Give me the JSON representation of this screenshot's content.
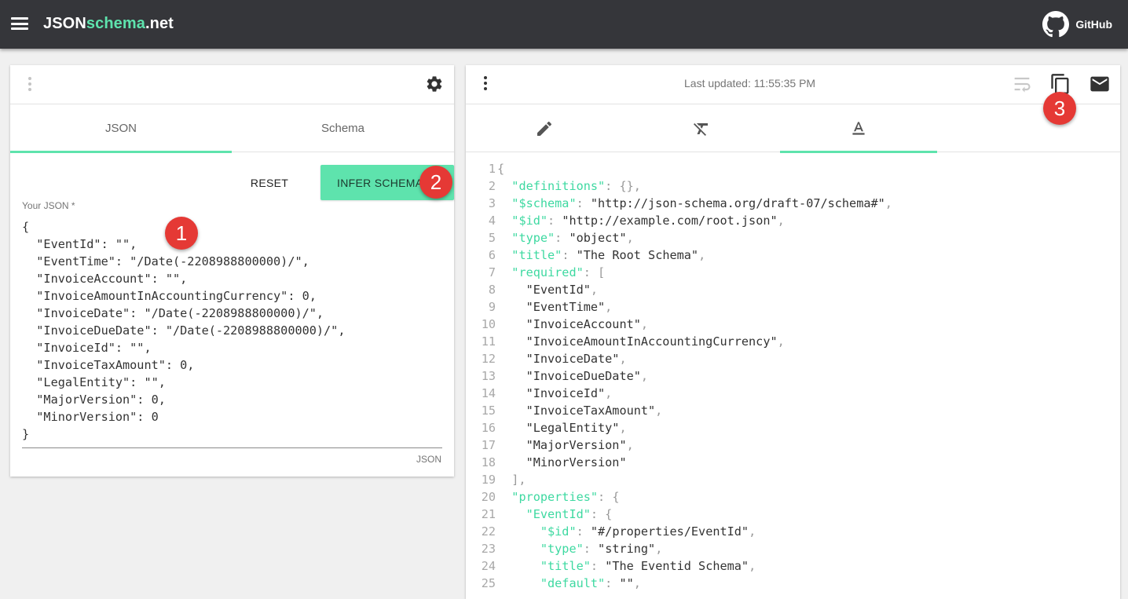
{
  "app": {
    "brand_part1": "JSON",
    "brand_part2": "schema",
    "brand_part3": ".net",
    "github_label": "GitHub"
  },
  "left_panel": {
    "tabs": [
      "JSON",
      "Schema"
    ],
    "active_tab": "JSON",
    "reset_label": "RESET",
    "infer_label": "INFER SCHEMA",
    "field_label": "Your JSON *",
    "field_hint": "JSON",
    "json_text": "{\n  \"EventId\": \"\",\n  \"EventTime\": \"/Date(-2208988800000)/\",\n  \"InvoiceAccount\": \"\",\n  \"InvoiceAmountInAccountingCurrency\": 0,\n  \"InvoiceDate\": \"/Date(-2208988800000)/\",\n  \"InvoiceDueDate\": \"/Date(-2208988800000)/\",\n  \"InvoiceId\": \"\",\n  \"InvoiceTaxAmount\": 0,\n  \"LegalEntity\": \"\",\n  \"MajorVersion\": 0,\n  \"MinorVersion\": 0\n}"
  },
  "right_panel": {
    "last_updated": "Last updated: 11:55:35 PM",
    "tabs": [
      "edit-icon",
      "clear-format-icon",
      "text-format-icon"
    ],
    "active_tab": "text-format-icon",
    "header_icons": [
      "wrap-text-icon",
      "copy-icon",
      "email-icon"
    ],
    "code_lines": [
      [
        [
          "p",
          "{"
        ]
      ],
      [
        [
          "p",
          "  "
        ],
        [
          "k",
          "\"definitions\""
        ],
        [
          "p",
          ": {},"
        ]
      ],
      [
        [
          "p",
          "  "
        ],
        [
          "k",
          "\"$schema\""
        ],
        [
          "p",
          ": "
        ],
        [
          "s",
          "\"http://json-schema.org/draft-07/schema#\""
        ],
        [
          "p",
          ","
        ]
      ],
      [
        [
          "p",
          "  "
        ],
        [
          "k",
          "\"$id\""
        ],
        [
          "p",
          ": "
        ],
        [
          "s",
          "\"http://example.com/root.json\""
        ],
        [
          "p",
          ","
        ]
      ],
      [
        [
          "p",
          "  "
        ],
        [
          "k",
          "\"type\""
        ],
        [
          "p",
          ": "
        ],
        [
          "s",
          "\"object\""
        ],
        [
          "p",
          ","
        ]
      ],
      [
        [
          "p",
          "  "
        ],
        [
          "k",
          "\"title\""
        ],
        [
          "p",
          ": "
        ],
        [
          "s",
          "\"The Root Schema\""
        ],
        [
          "p",
          ","
        ]
      ],
      [
        [
          "p",
          "  "
        ],
        [
          "k",
          "\"required\""
        ],
        [
          "p",
          ": ["
        ]
      ],
      [
        [
          "p",
          "    "
        ],
        [
          "s",
          "\"EventId\""
        ],
        [
          "p",
          ","
        ]
      ],
      [
        [
          "p",
          "    "
        ],
        [
          "s",
          "\"EventTime\""
        ],
        [
          "p",
          ","
        ]
      ],
      [
        [
          "p",
          "    "
        ],
        [
          "s",
          "\"InvoiceAccount\""
        ],
        [
          "p",
          ","
        ]
      ],
      [
        [
          "p",
          "    "
        ],
        [
          "s",
          "\"InvoiceAmountInAccountingCurrency\""
        ],
        [
          "p",
          ","
        ]
      ],
      [
        [
          "p",
          "    "
        ],
        [
          "s",
          "\"InvoiceDate\""
        ],
        [
          "p",
          ","
        ]
      ],
      [
        [
          "p",
          "    "
        ],
        [
          "s",
          "\"InvoiceDueDate\""
        ],
        [
          "p",
          ","
        ]
      ],
      [
        [
          "p",
          "    "
        ],
        [
          "s",
          "\"InvoiceId\""
        ],
        [
          "p",
          ","
        ]
      ],
      [
        [
          "p",
          "    "
        ],
        [
          "s",
          "\"InvoiceTaxAmount\""
        ],
        [
          "p",
          ","
        ]
      ],
      [
        [
          "p",
          "    "
        ],
        [
          "s",
          "\"LegalEntity\""
        ],
        [
          "p",
          ","
        ]
      ],
      [
        [
          "p",
          "    "
        ],
        [
          "s",
          "\"MajorVersion\""
        ],
        [
          "p",
          ","
        ]
      ],
      [
        [
          "p",
          "    "
        ],
        [
          "s",
          "\"MinorVersion\""
        ]
      ],
      [
        [
          "p",
          "  ],"
        ]
      ],
      [
        [
          "p",
          "  "
        ],
        [
          "k",
          "\"properties\""
        ],
        [
          "p",
          ": {"
        ]
      ],
      [
        [
          "p",
          "    "
        ],
        [
          "k",
          "\"EventId\""
        ],
        [
          "p",
          ": {"
        ]
      ],
      [
        [
          "p",
          "      "
        ],
        [
          "k",
          "\"$id\""
        ],
        [
          "p",
          ": "
        ],
        [
          "s",
          "\"#/properties/EventId\""
        ],
        [
          "p",
          ","
        ]
      ],
      [
        [
          "p",
          "      "
        ],
        [
          "k",
          "\"type\""
        ],
        [
          "p",
          ": "
        ],
        [
          "s",
          "\"string\""
        ],
        [
          "p",
          ","
        ]
      ],
      [
        [
          "p",
          "      "
        ],
        [
          "k",
          "\"title\""
        ],
        [
          "p",
          ": "
        ],
        [
          "s",
          "\"The Eventid Schema\""
        ],
        [
          "p",
          ","
        ]
      ],
      [
        [
          "p",
          "      "
        ],
        [
          "k",
          "\"default\""
        ],
        [
          "p",
          ": "
        ],
        [
          "s",
          "\"\""
        ],
        [
          "p",
          ","
        ]
      ]
    ]
  },
  "badges": [
    "1",
    "2",
    "3"
  ],
  "colors": {
    "accent": "#5ee3ad",
    "topbar": "#35363a",
    "badge": "#e53935",
    "key": "#3ed9a1"
  }
}
